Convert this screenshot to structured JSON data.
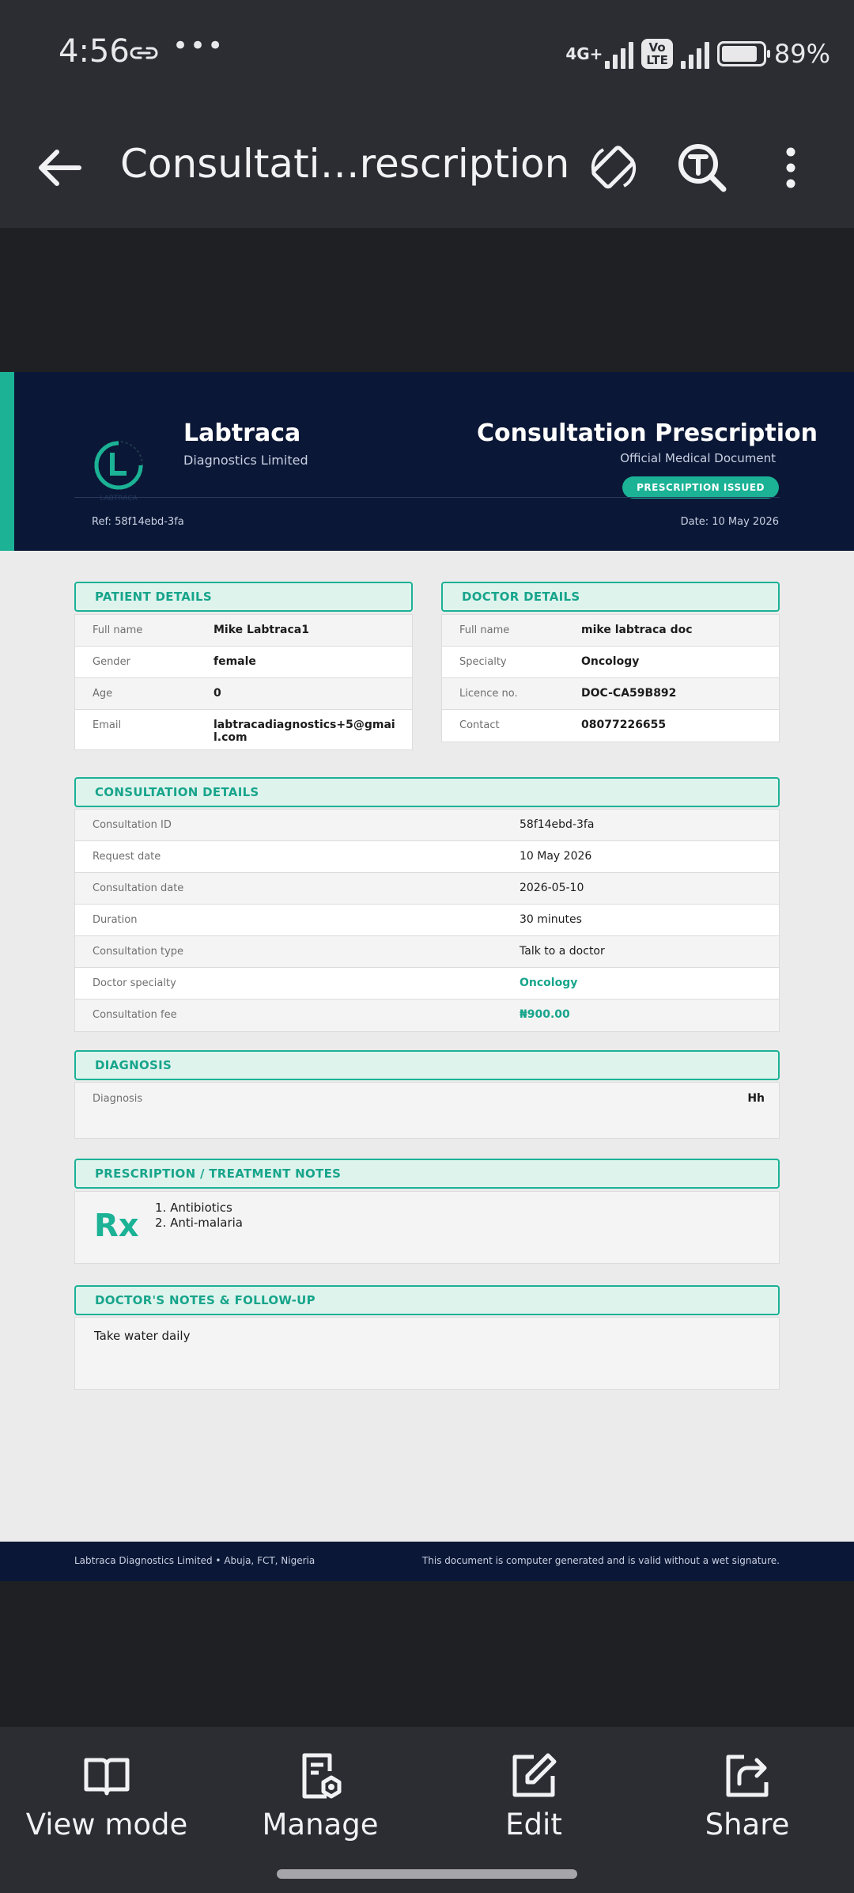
{
  "status_bar": {
    "time": "4:56",
    "dots": "•••",
    "network": "4G+",
    "volte": "Vo\nLTE",
    "battery_percent": "89%",
    "battery_level": 0.89
  },
  "app_bar": {
    "title": "Consultati…rescription"
  },
  "document": {
    "brand_name": "Labtraca",
    "brand_sub": "Diagnostics Limited",
    "logo_text": "LABTRACA",
    "title": "Consultation Prescription",
    "subtitle": "Official Medical Document",
    "badge": "PRESCRIPTION ISSUED",
    "ref": "Ref: 58f14ebd-3fa",
    "date": "Date: 10 May 2026",
    "patient": {
      "heading": "PATIENT DETAILS",
      "rows": [
        {
          "label": "Full name",
          "value": "Mike Labtraca1"
        },
        {
          "label": "Gender",
          "value": "female"
        },
        {
          "label": "Age",
          "value": "0"
        },
        {
          "label": "Email",
          "value": "labtracadiagnostics+5@gmai l.com"
        }
      ]
    },
    "doctor": {
      "heading": "DOCTOR DETAILS",
      "rows": [
        {
          "label": "Full name",
          "value": "mike labtraca doc"
        },
        {
          "label": "Specialty",
          "value": "Oncology"
        },
        {
          "label": "Licence no.",
          "value": "DOC-CA59B892"
        },
        {
          "label": "Contact",
          "value": "08077226655"
        }
      ]
    },
    "consultation": {
      "heading": "CONSULTATION DETAILS",
      "rows": [
        {
          "label": "Consultation ID",
          "value": "58f14ebd-3fa"
        },
        {
          "label": "Request date",
          "value": "10 May 2026"
        },
        {
          "label": "Consultation date",
          "value": "2026-05-10"
        },
        {
          "label": "Duration",
          "value": "30 minutes"
        },
        {
          "label": "Consultation type",
          "value": "Talk to a doctor"
        },
        {
          "label": "Doctor specialty",
          "value": "Oncology"
        },
        {
          "label": "Consultation fee",
          "value": "₦900.00"
        }
      ]
    },
    "diagnosis": {
      "heading": "DIAGNOSIS",
      "label": "Diagnosis",
      "value": "Hh"
    },
    "prescription": {
      "heading": "PRESCRIPTION / TREATMENT NOTES",
      "rx": "Rx",
      "items": [
        "1. Antibiotics",
        "2. Anti-malaria"
      ]
    },
    "notes": {
      "heading": "DOCTOR'S NOTES & FOLLOW-UP",
      "text": "Take water daily"
    },
    "footer_left": "Labtraca Diagnostics Limited • Abuja, FCT, Nigeria",
    "footer_right": "This document is computer generated and is valid without a wet signature."
  },
  "bottom_nav": {
    "view_mode": "View mode",
    "manage": "Manage",
    "edit": "Edit",
    "share": "Share"
  },
  "colors": {
    "accent": "#1bb296",
    "header_navy": "#0b1736",
    "chrome": "#2b2d33"
  },
  "icons": [
    "link-icon",
    "back-arrow-icon",
    "rotate-icon",
    "text-search-icon",
    "more-vert-icon",
    "book-icon",
    "manage-doc-icon",
    "edit-icon",
    "share-icon"
  ]
}
